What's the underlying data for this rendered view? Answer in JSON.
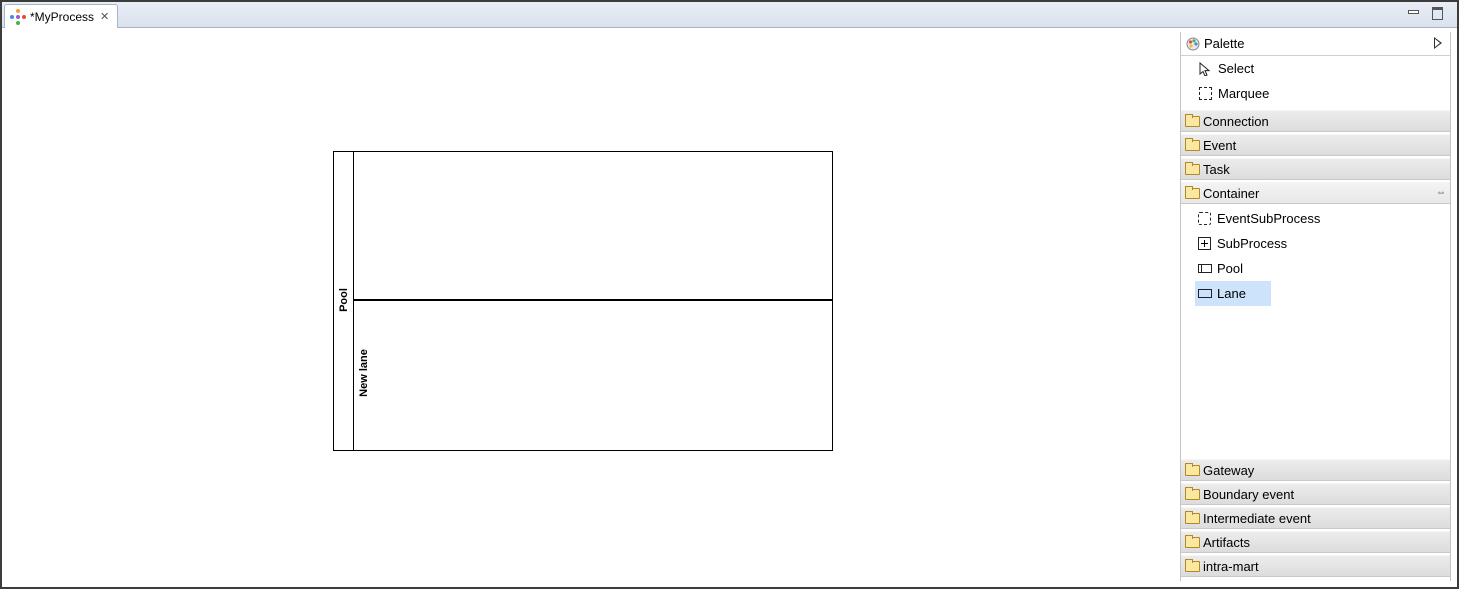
{
  "editor": {
    "tab_title": "*MyProcess"
  },
  "diagram": {
    "pool_label": "Pool",
    "lane_label": "New lane"
  },
  "palette": {
    "title": "Palette",
    "tools": [
      {
        "label": "Select",
        "icon": "cursor-arrow-icon"
      },
      {
        "label": "Marquee",
        "icon": "marquee-icon"
      }
    ],
    "drawers_top": [
      {
        "label": "Connection"
      },
      {
        "label": "Event"
      },
      {
        "label": "Task"
      }
    ],
    "container": {
      "label": "Container",
      "items": [
        {
          "label": "EventSubProcess",
          "icon": "event-subprocess-icon"
        },
        {
          "label": "SubProcess",
          "icon": "subprocess-icon"
        },
        {
          "label": "Pool",
          "icon": "pool-icon"
        },
        {
          "label": "Lane",
          "icon": "lane-icon",
          "selected": true
        }
      ]
    },
    "drawers_bottom": [
      {
        "label": "Gateway"
      },
      {
        "label": "Boundary event"
      },
      {
        "label": "Intermediate event"
      },
      {
        "label": "Artifacts"
      },
      {
        "label": "intra-mart"
      }
    ]
  },
  "colors": {
    "selection_bg": "#cde3fb",
    "tabbar_bg": "#dfe6f0",
    "folder": "#fbe7a0"
  }
}
